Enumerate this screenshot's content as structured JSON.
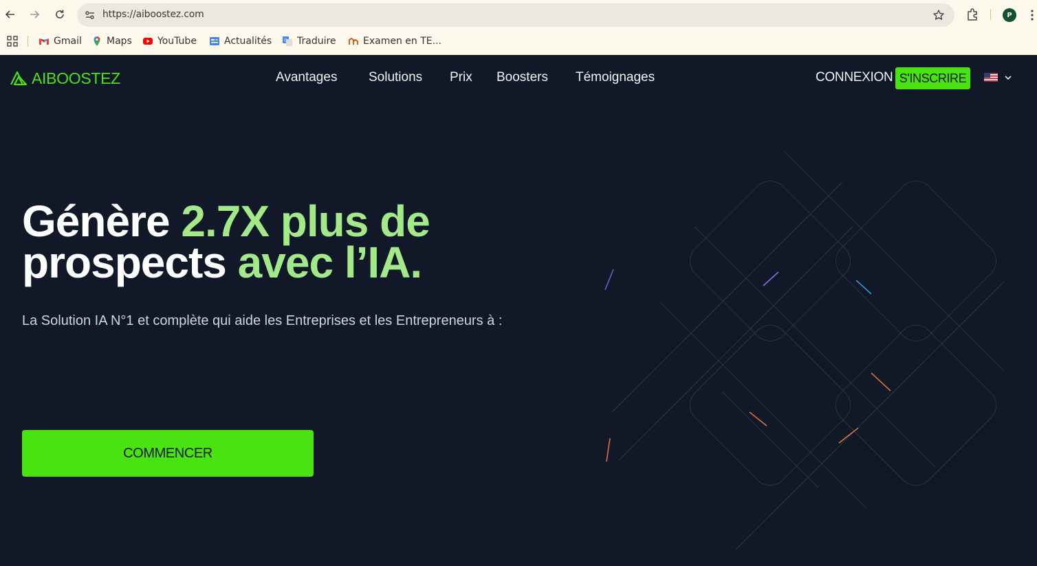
{
  "browser": {
    "url": "https://aiboostez.com",
    "avatar_letter": "P",
    "bookmarks": [
      {
        "label": "Gmail",
        "icon": "gmail-icon"
      },
      {
        "label": "Maps",
        "icon": "maps-icon"
      },
      {
        "label": "YouTube",
        "icon": "youtube-icon"
      },
      {
        "label": "Actualités",
        "icon": "news-icon"
      },
      {
        "label": "Traduire",
        "icon": "translate-icon"
      },
      {
        "label": "Examen en TE...",
        "icon": "site-icon"
      }
    ]
  },
  "site": {
    "brand": "AIBOOSTEZ",
    "menu": [
      "Avantages",
      "Solutions",
      "Prix",
      "Boosters",
      "Témoignages"
    ],
    "login_label": "CONNEXION",
    "signup_label": "S'INSCRIRE",
    "language": "us-flag"
  },
  "hero": {
    "title_line1_a": "Génère ",
    "title_line1_b": "2.7X plus de",
    "title_line2_a": "prospects ",
    "title_line2_b": "avec l’IA.",
    "subtitle": "La Solution IA N°1 et complète qui aide les Entreprises et les Entrepreneurs à :",
    "cta_label": "COMMENCER"
  },
  "colors": {
    "accent": "#4ae312",
    "highlight": "#a3e98a",
    "background": "#111827"
  }
}
